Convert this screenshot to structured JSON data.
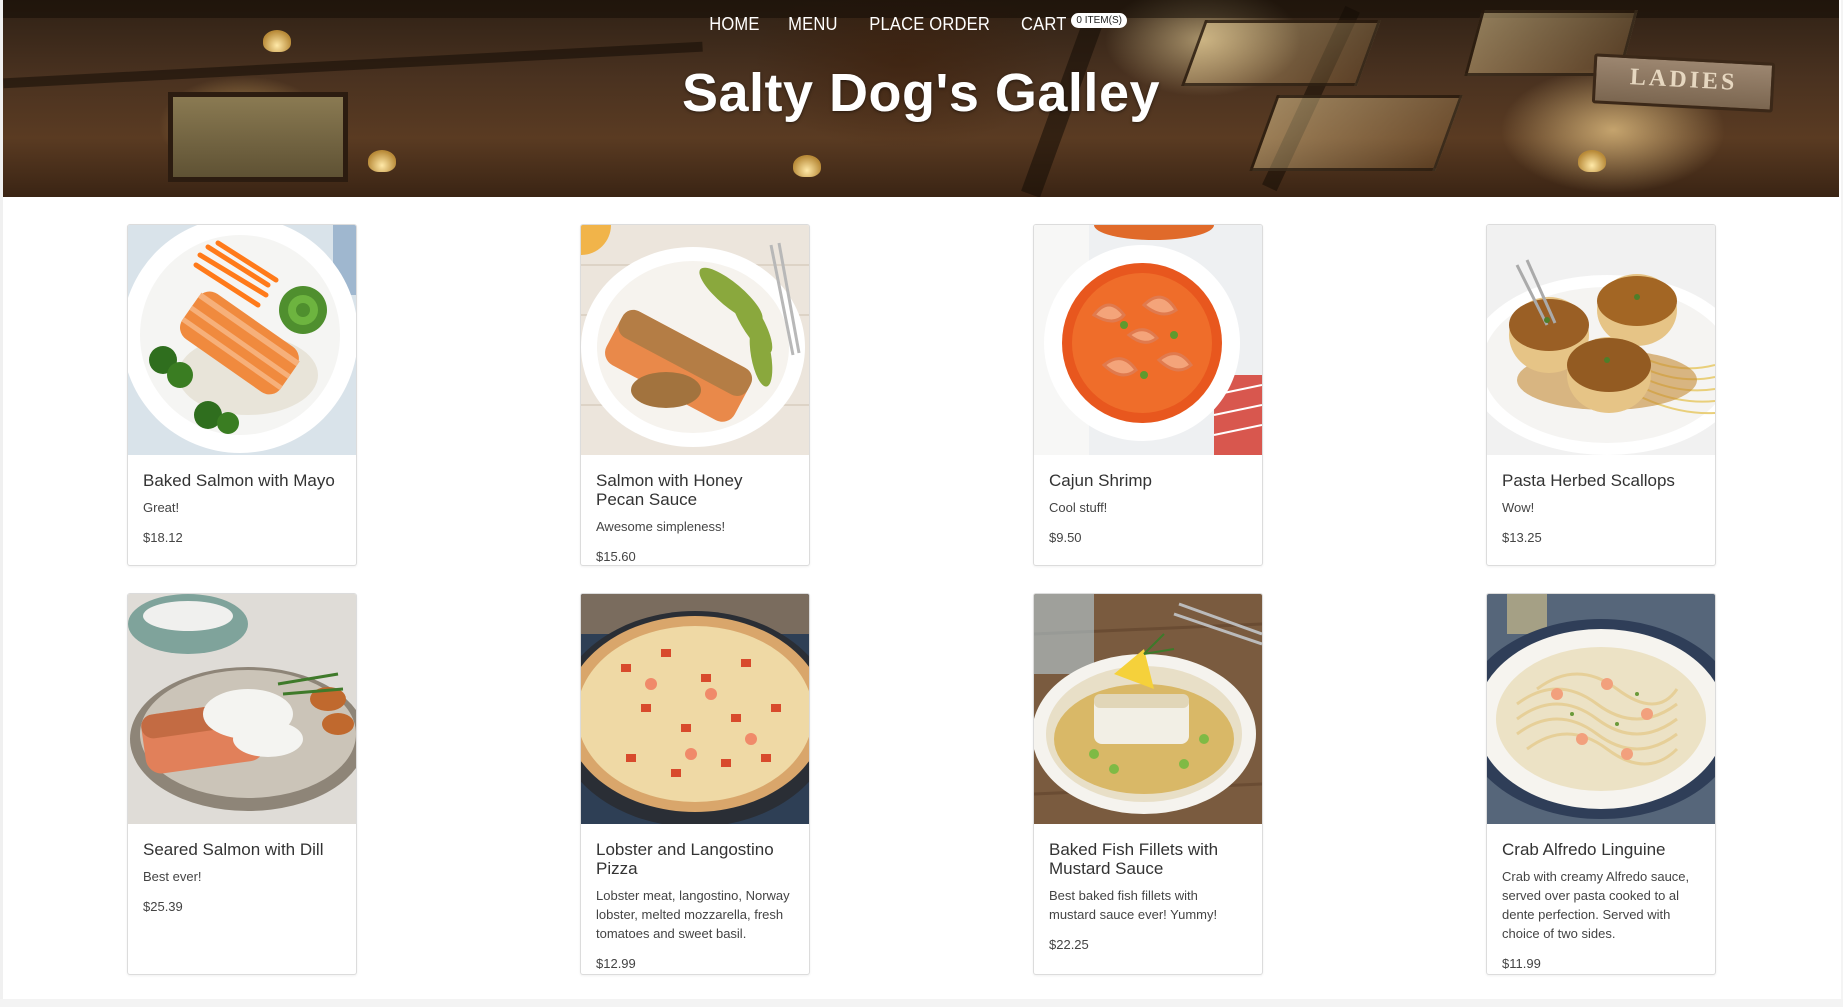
{
  "nav": {
    "home": "HOME",
    "menu": "MENU",
    "place_order": "PLACE ORDER",
    "cart": "CART",
    "cart_badge": "0 ITEM(S)"
  },
  "site": {
    "title": "Salty Dog's Galley",
    "sign": "LADIES"
  },
  "menu_items": [
    {
      "name": "Baked Salmon with Mayo",
      "description": "Great!",
      "price": "$18.12"
    },
    {
      "name": "Salmon with Honey Pecan Sauce",
      "description": "Awesome simpleness!",
      "price": "$15.60"
    },
    {
      "name": "Cajun Shrimp",
      "description": "Cool stuff!",
      "price": "$9.50"
    },
    {
      "name": "Pasta Herbed Scallops",
      "description": "Wow!",
      "price": "$13.25"
    },
    {
      "name": "Seared Salmon with Dill",
      "description": "Best ever!",
      "price": "$25.39"
    },
    {
      "name": "Lobster and Langostino Pizza",
      "description": "Lobster meat, langostino, Norway lobster, melted mozzarella, fresh tomatoes and sweet basil.",
      "price": "$12.99"
    },
    {
      "name": "Baked Fish Fillets with Mustard Sauce",
      "description": "Best baked fish fillets with mustard sauce ever! Yummy!",
      "price": "$22.25"
    },
    {
      "name": "Crab Alfredo Linguine",
      "description": "Crab with creamy Alfredo sauce, served over pasta cooked to al dente perfection. Served with choice of two sides.",
      "price": "$11.99"
    }
  ]
}
